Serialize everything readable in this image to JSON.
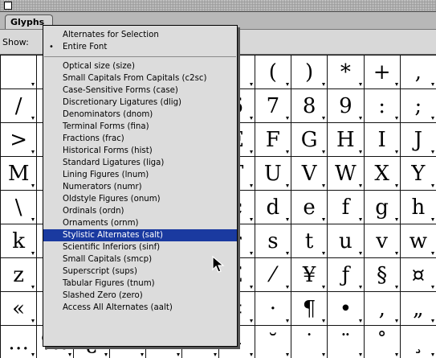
{
  "window": {
    "tab_label": "Glyphs",
    "show_label": "Show:"
  },
  "menu": {
    "top_items": [
      {
        "label": "Alternates for Selection",
        "checked": false
      },
      {
        "label": "Entire Font",
        "checked": true
      }
    ],
    "feature_items": [
      {
        "label": "Optical size (size)"
      },
      {
        "label": "Small Capitals From Capitals (c2sc)"
      },
      {
        "label": "Case-Sensitive Forms (case)"
      },
      {
        "label": "Discretionary Ligatures (dlig)"
      },
      {
        "label": "Denominators (dnom)"
      },
      {
        "label": "Terminal Forms (fina)"
      },
      {
        "label": "Fractions (frac)"
      },
      {
        "label": "Historical Forms (hist)"
      },
      {
        "label": "Standard Ligatures (liga)"
      },
      {
        "label": "Lining Figures (lnum)"
      },
      {
        "label": "Numerators (numr)"
      },
      {
        "label": "Oldstyle Figures (onum)"
      },
      {
        "label": "Ordinals (ordn)"
      },
      {
        "label": "Ornaments (ornm)"
      },
      {
        "label": "Stylistic Alternates (salt)",
        "selected": true
      },
      {
        "label": "Scientific Inferiors (sinf)"
      },
      {
        "label": "Small Capitals (smcp)"
      },
      {
        "label": "Superscript (sups)"
      },
      {
        "label": "Tabular Figures (tnum)"
      },
      {
        "label": "Slashed Zero (zero)"
      },
      {
        "label": "Access All Alternates (aalt)"
      }
    ]
  },
  "glyph_grid": {
    "rows": [
      [
        "",
        "",
        "",
        "",
        "",
        "",
        "’",
        "(",
        ")",
        "*",
        "+",
        ","
      ],
      [
        "/",
        "",
        "",
        "",
        "",
        "",
        "6",
        "7",
        "8",
        "9",
        ":",
        ";"
      ],
      [
        ">",
        "",
        "",
        "",
        "",
        "",
        "E",
        "F",
        "G",
        "H",
        "I",
        "J"
      ],
      [
        "M",
        "",
        "",
        "",
        "",
        "",
        "T",
        "U",
        "V",
        "W",
        "X",
        "Y"
      ],
      [
        "\\",
        "",
        "",
        "",
        "",
        "",
        "c",
        "d",
        "e",
        "f",
        "g",
        "h"
      ],
      [
        "k",
        "",
        "",
        "",
        "",
        "",
        "r",
        "s",
        "t",
        "u",
        "v",
        "w"
      ],
      [
        "z",
        "",
        "",
        "",
        "",
        "",
        "£",
        "⁄",
        "¥",
        "ƒ",
        "§",
        "¤"
      ],
      [
        "«",
        "",
        "",
        "",
        "",
        "",
        "‡",
        "·",
        "¶",
        "•",
        "‚",
        "„"
      ],
      [
        "…",
        "‰",
        "¿",
        "",
        "",
        "",
        "–",
        "˘",
        "˙",
        "¨",
        "˚",
        "¸"
      ]
    ]
  }
}
